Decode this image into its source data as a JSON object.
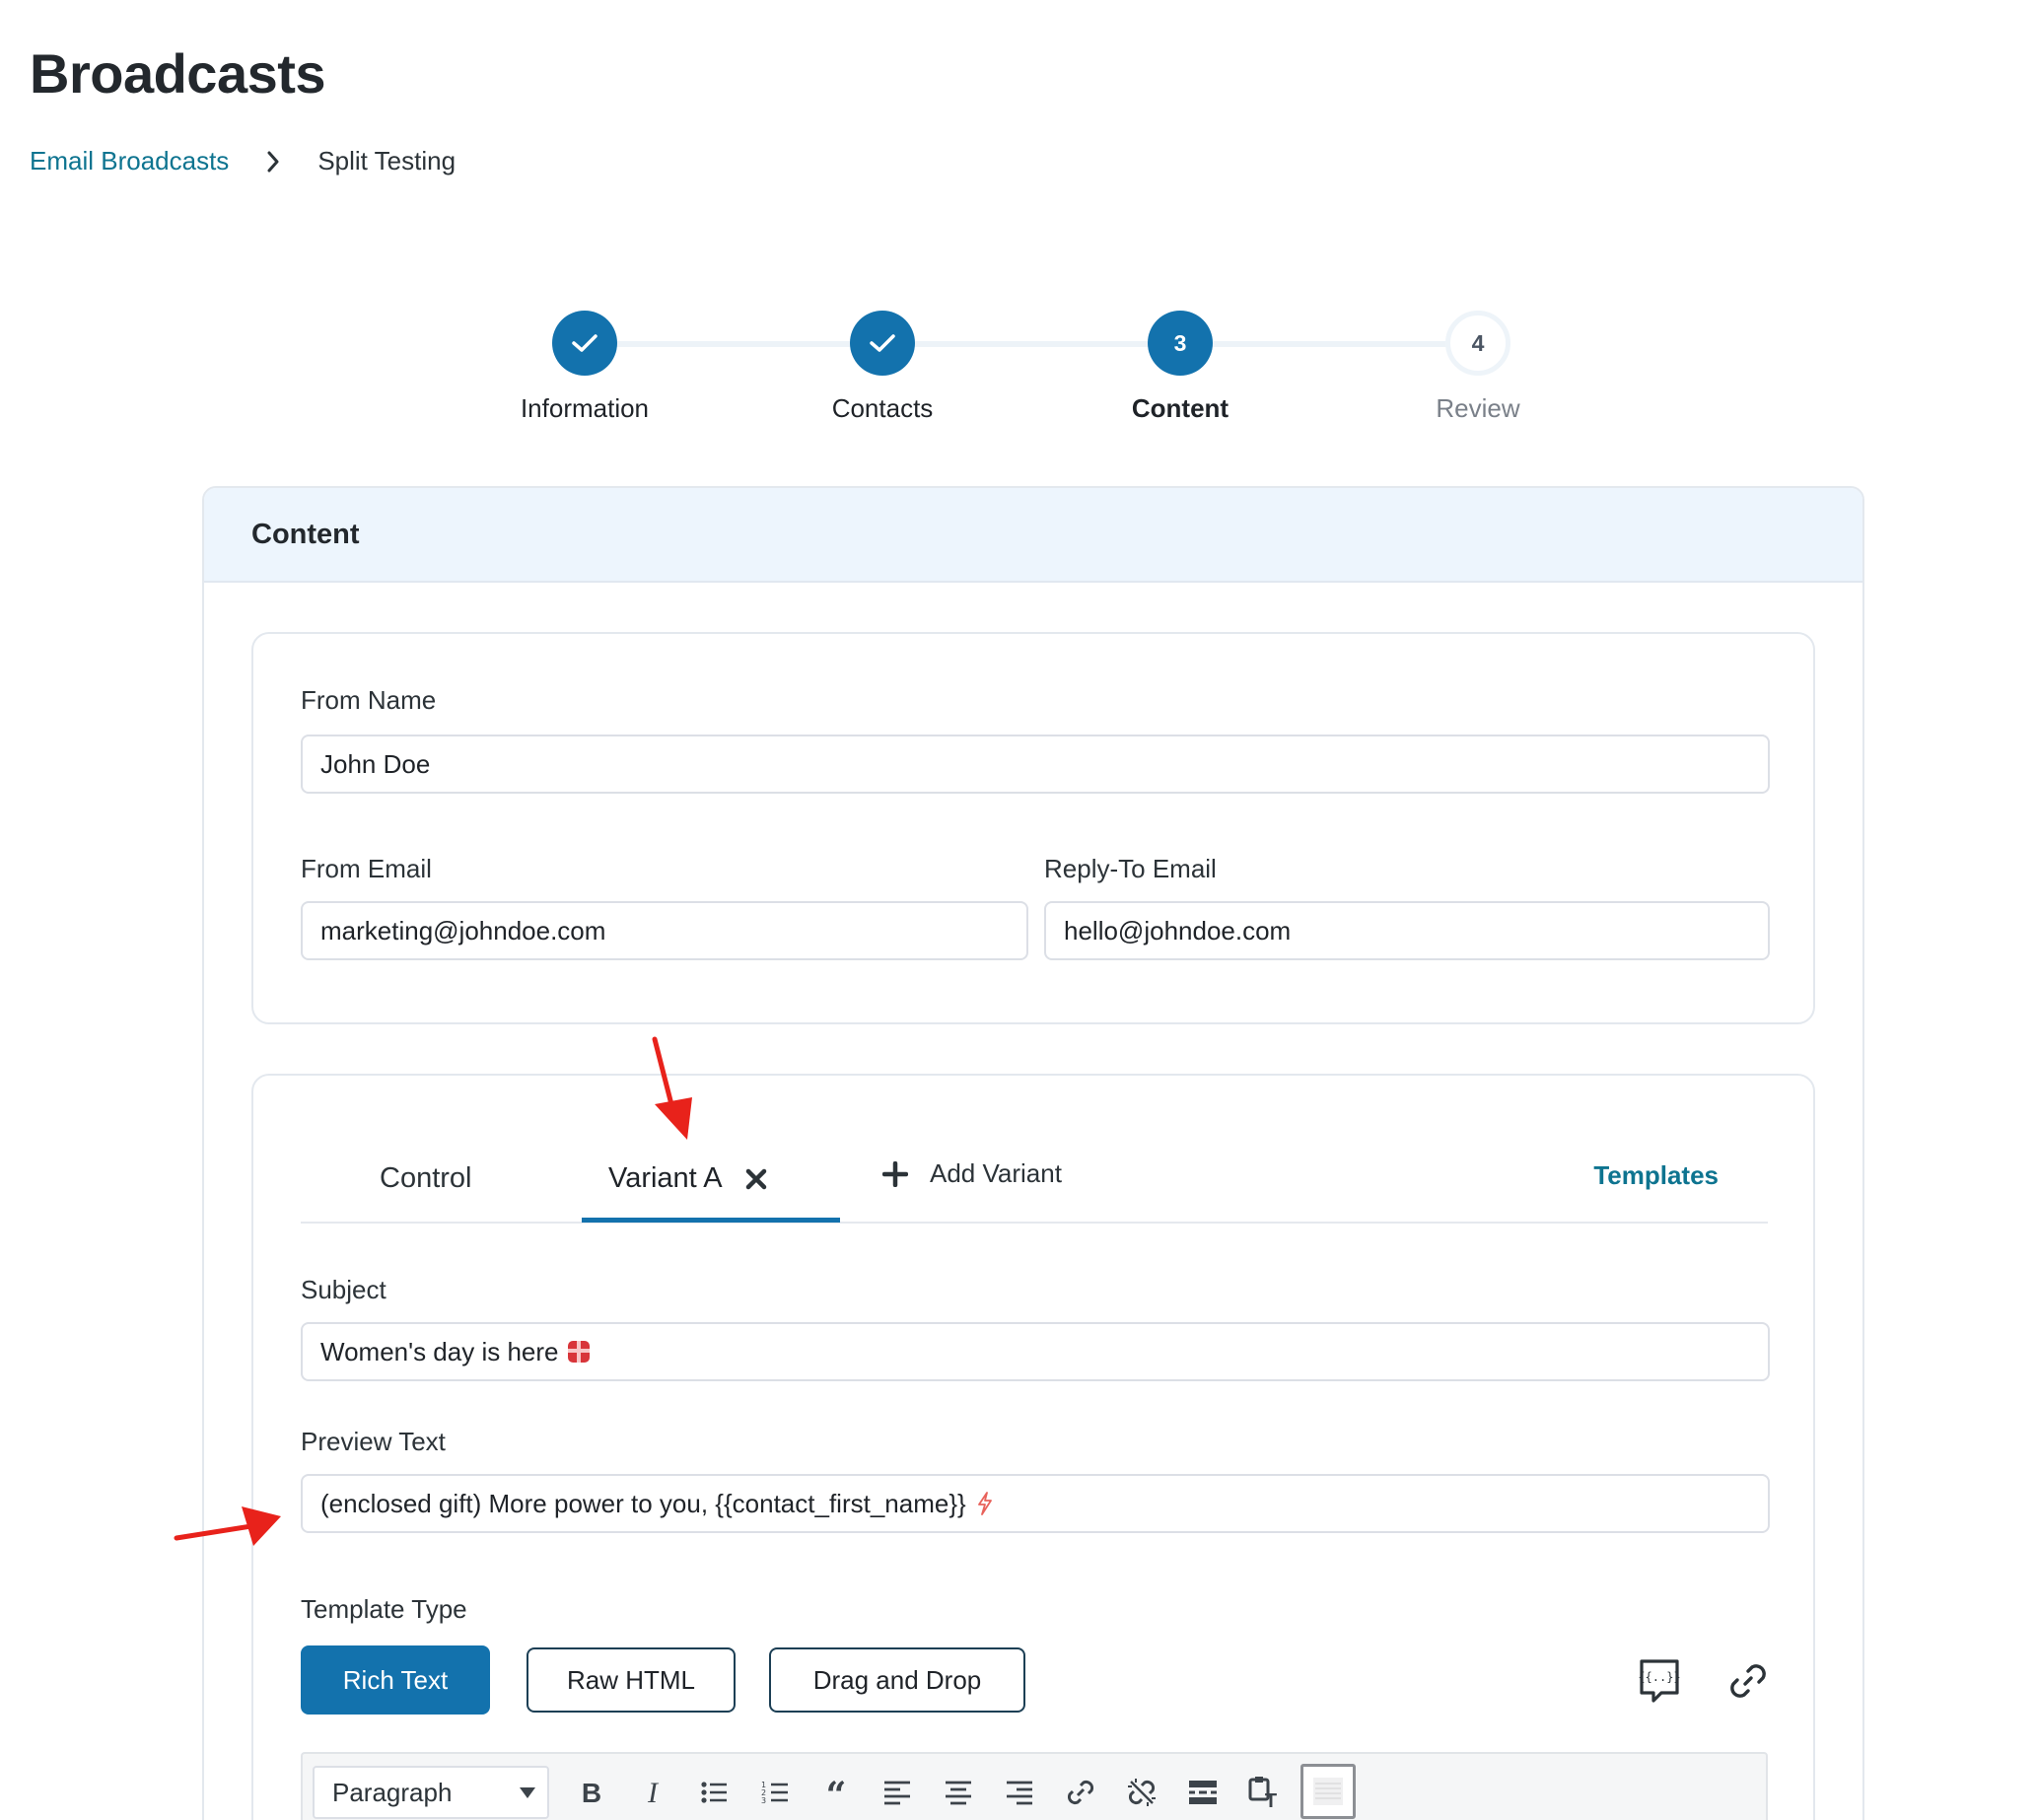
{
  "page": {
    "title": "Broadcasts"
  },
  "breadcrumb": {
    "parent": "Email Broadcasts",
    "current": "Split Testing"
  },
  "stepper": {
    "steps": [
      {
        "number": "1",
        "label": "Information",
        "state": "done"
      },
      {
        "number": "2",
        "label": "Contacts",
        "state": "done"
      },
      {
        "number": "3",
        "label": "Content",
        "state": "active"
      },
      {
        "number": "4",
        "label": "Review",
        "state": "pending"
      }
    ]
  },
  "content": {
    "header": "Content",
    "sender": {
      "from_name_label": "From Name",
      "from_name_value": "John Doe",
      "from_email_label": "From Email",
      "from_email_value": "marketing@johndoe.com",
      "reply_to_label": "Reply-To Email",
      "reply_to_value": "hello@johndoe.com"
    },
    "tabs": {
      "control": "Control",
      "variant_a": "Variant A",
      "add_variant": "Add Variant",
      "templates": "Templates",
      "active": "Variant A"
    },
    "subject_label": "Subject",
    "subject_value": "Women's day is here",
    "preview_label": "Preview Text",
    "preview_value": "(enclosed gift) More power to you, {{contact_first_name}}",
    "template_type_label": "Template Type",
    "template_types": [
      "Rich Text",
      "Raw HTML",
      "Drag and Drop"
    ],
    "template_type_selected": "Rich Text"
  },
  "editor": {
    "format_value": "Paragraph",
    "toolbar_icons": [
      "bold-icon",
      "italic-icon",
      "bullet-list-icon",
      "numbered-list-icon",
      "blockquote-icon",
      "align-left-icon",
      "align-center-icon",
      "align-right-icon",
      "link-icon",
      "unlink-icon",
      "read-more-icon",
      "paste-text-icon",
      "toolbar-toggle-icon"
    ]
  },
  "colors": {
    "primary": "#1372ad",
    "link": "#0e7490",
    "annotation_arrow": "#e8221b",
    "header_bg": "#edf5fd"
  }
}
